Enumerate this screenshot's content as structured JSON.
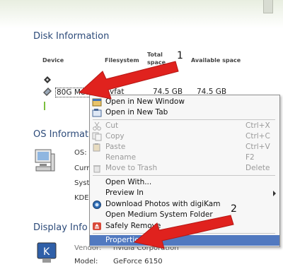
{
  "disk": {
    "title": "Disk Information",
    "headers": {
      "device": "Device",
      "filesystem": "Filesystem",
      "total_space": "Total space",
      "available_space": "Available space"
    },
    "row": {
      "device": "80G Media",
      "filesystem": "vfat",
      "total": "74.5 GB",
      "available": "74.5 GB"
    }
  },
  "os": {
    "title": "OS Informat",
    "labels": [
      "OS:",
      "Curr",
      "Syst",
      "KDE"
    ]
  },
  "display": {
    "title": "Display Info",
    "vendor_label": "Vendor:",
    "vendor_value": "nvidia Corporation",
    "model_label": "Model:",
    "model_value": "GeForce 6150"
  },
  "menu": {
    "items": [
      {
        "label": "Open in New Window",
        "icon": "folder-window-icon"
      },
      {
        "label": "Open in New Tab",
        "icon": "new-tab-icon"
      },
      {
        "label": "Cut",
        "shortcut": "Ctrl+X",
        "disabled": true,
        "icon": "scissors-icon"
      },
      {
        "label": "Copy",
        "shortcut": "Ctrl+C",
        "disabled": true,
        "icon": "copy-icon"
      },
      {
        "label": "Paste",
        "shortcut": "Ctrl+V",
        "disabled": true,
        "icon": "paste-icon"
      },
      {
        "label": "Rename",
        "shortcut": "F2",
        "disabled": true
      },
      {
        "label": "Move to Trash",
        "shortcut": "Delete",
        "disabled": true,
        "icon": "trash-icon"
      },
      {
        "label": "Open With..."
      },
      {
        "label": "Preview In",
        "submenu": true
      },
      {
        "label": "Download Photos with digiKam",
        "icon": "digikam-icon"
      },
      {
        "label": "Open Medium System Folder"
      },
      {
        "label": "Safely Remove",
        "icon": "eject-icon"
      },
      {
        "label": "Properties",
        "highlighted": true
      }
    ]
  },
  "annotations": {
    "one": "1",
    "two": "2"
  },
  "colors": {
    "menu_highlight": "#5179c0",
    "arrow": "#e0221e",
    "section_title": "#2c4a79"
  }
}
